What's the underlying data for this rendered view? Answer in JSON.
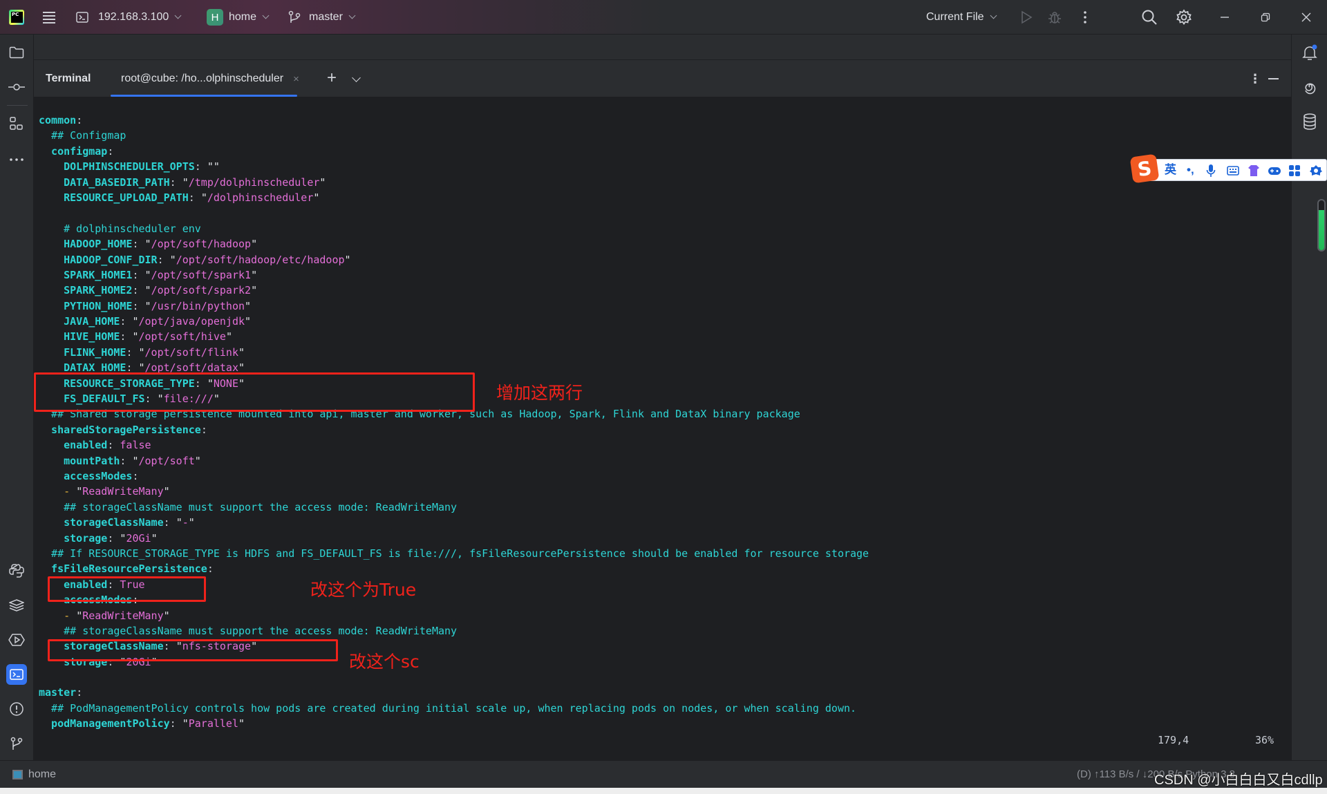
{
  "titlebar": {
    "host": "192.168.3.100",
    "project_badge": "H",
    "project": "home",
    "branch": "master",
    "run_config": "Current File"
  },
  "terminal": {
    "title": "Terminal",
    "tab_label": "root@cube: /ho...olphinscheduler",
    "tab_close": "×",
    "add": "+",
    "more": "⋮"
  },
  "code": {
    "lines": [
      [
        {
          "t": "k",
          "v": "common"
        },
        {
          "t": "p",
          "v": ":"
        }
      ],
      [
        {
          "t": "c",
          "v": "  ## Configmap"
        }
      ],
      [
        {
          "t": "k",
          "v": "  configmap"
        },
        {
          "t": "p",
          "v": ":"
        }
      ],
      [
        {
          "t": "k",
          "v": "    DOLPHINSCHEDULER_OPTS"
        },
        {
          "t": "p",
          "v": ": "
        },
        {
          "t": "q",
          "v": "\"\""
        }
      ],
      [
        {
          "t": "k",
          "v": "    DATA_BASEDIR_PATH"
        },
        {
          "t": "p",
          "v": ": "
        },
        {
          "t": "q",
          "v": "\""
        },
        {
          "t": "s",
          "v": "/tmp/dolphinscheduler"
        },
        {
          "t": "q",
          "v": "\""
        }
      ],
      [
        {
          "t": "k",
          "v": "    RESOURCE_UPLOAD_PATH"
        },
        {
          "t": "p",
          "v": ": "
        },
        {
          "t": "q",
          "v": "\""
        },
        {
          "t": "s",
          "v": "/dolphinscheduler"
        },
        {
          "t": "q",
          "v": "\""
        }
      ],
      [],
      [
        {
          "t": "c",
          "v": "    # dolphinscheduler env"
        }
      ],
      [
        {
          "t": "k",
          "v": "    HADOOP_HOME"
        },
        {
          "t": "p",
          "v": ": "
        },
        {
          "t": "q",
          "v": "\""
        },
        {
          "t": "s",
          "v": "/opt/soft/hadoop"
        },
        {
          "t": "q",
          "v": "\""
        }
      ],
      [
        {
          "t": "k",
          "v": "    HADOOP_CONF_DIR"
        },
        {
          "t": "p",
          "v": ": "
        },
        {
          "t": "q",
          "v": "\""
        },
        {
          "t": "s",
          "v": "/opt/soft/hadoop/etc/hadoop"
        },
        {
          "t": "q",
          "v": "\""
        }
      ],
      [
        {
          "t": "k",
          "v": "    SPARK_HOME1"
        },
        {
          "t": "p",
          "v": ": "
        },
        {
          "t": "q",
          "v": "\""
        },
        {
          "t": "s",
          "v": "/opt/soft/spark1"
        },
        {
          "t": "q",
          "v": "\""
        }
      ],
      [
        {
          "t": "k",
          "v": "    SPARK_HOME2"
        },
        {
          "t": "p",
          "v": ": "
        },
        {
          "t": "q",
          "v": "\""
        },
        {
          "t": "s",
          "v": "/opt/soft/spark2"
        },
        {
          "t": "q",
          "v": "\""
        }
      ],
      [
        {
          "t": "k",
          "v": "    PYTHON_HOME"
        },
        {
          "t": "p",
          "v": ": "
        },
        {
          "t": "q",
          "v": "\""
        },
        {
          "t": "s",
          "v": "/usr/bin/python"
        },
        {
          "t": "q",
          "v": "\""
        }
      ],
      [
        {
          "t": "k",
          "v": "    JAVA_HOME"
        },
        {
          "t": "p",
          "v": ": "
        },
        {
          "t": "q",
          "v": "\""
        },
        {
          "t": "s",
          "v": "/opt/java/openjdk"
        },
        {
          "t": "q",
          "v": "\""
        }
      ],
      [
        {
          "t": "k",
          "v": "    HIVE_HOME"
        },
        {
          "t": "p",
          "v": ": "
        },
        {
          "t": "q",
          "v": "\""
        },
        {
          "t": "s",
          "v": "/opt/soft/hive"
        },
        {
          "t": "q",
          "v": "\""
        }
      ],
      [
        {
          "t": "k",
          "v": "    FLINK_HOME"
        },
        {
          "t": "p",
          "v": ": "
        },
        {
          "t": "q",
          "v": "\""
        },
        {
          "t": "s",
          "v": "/opt/soft/flink"
        },
        {
          "t": "q",
          "v": "\""
        }
      ],
      [
        {
          "t": "k",
          "v": "    DATAX_HOME"
        },
        {
          "t": "p",
          "v": ": "
        },
        {
          "t": "q",
          "v": "\""
        },
        {
          "t": "s",
          "v": "/opt/soft/datax"
        },
        {
          "t": "q",
          "v": "\""
        }
      ],
      [
        {
          "t": "k",
          "v": "    RESOURCE_STORAGE_TYPE"
        },
        {
          "t": "p",
          "v": ": "
        },
        {
          "t": "q",
          "v": "\""
        },
        {
          "t": "s",
          "v": "NONE"
        },
        {
          "t": "q",
          "v": "\""
        }
      ],
      [
        {
          "t": "k",
          "v": "    FS_DEFAULT_FS"
        },
        {
          "t": "p",
          "v": ": "
        },
        {
          "t": "q",
          "v": "\""
        },
        {
          "t": "s",
          "v": "file:///"
        },
        {
          "t": "q",
          "v": "\""
        }
      ],
      [
        {
          "t": "c",
          "v": "  ## Shared storage persistence mounted into api, master and worker, such as Hadoop, Spark, Flink and DataX binary package"
        }
      ],
      [
        {
          "t": "k",
          "v": "  sharedStoragePersistence"
        },
        {
          "t": "p",
          "v": ":"
        }
      ],
      [
        {
          "t": "k",
          "v": "    enabled"
        },
        {
          "t": "p",
          "v": ": "
        },
        {
          "t": "bool",
          "v": "false"
        }
      ],
      [
        {
          "t": "k",
          "v": "    mountPath"
        },
        {
          "t": "p",
          "v": ": "
        },
        {
          "t": "q",
          "v": "\""
        },
        {
          "t": "s",
          "v": "/opt/soft"
        },
        {
          "t": "q",
          "v": "\""
        }
      ],
      [
        {
          "t": "k",
          "v": "    accessModes"
        },
        {
          "t": "p",
          "v": ":"
        }
      ],
      [
        {
          "t": "d",
          "v": "    - "
        },
        {
          "t": "q",
          "v": "\""
        },
        {
          "t": "s",
          "v": "ReadWriteMany"
        },
        {
          "t": "q",
          "v": "\""
        }
      ],
      [
        {
          "t": "c",
          "v": "    ## storageClassName must support the access mode: ReadWriteMany"
        }
      ],
      [
        {
          "t": "k",
          "v": "    storageClassName"
        },
        {
          "t": "p",
          "v": ": "
        },
        {
          "t": "q",
          "v": "\""
        },
        {
          "t": "s",
          "v": "-"
        },
        {
          "t": "q",
          "v": "\""
        }
      ],
      [
        {
          "t": "k",
          "v": "    storage"
        },
        {
          "t": "p",
          "v": ": "
        },
        {
          "t": "q",
          "v": "\""
        },
        {
          "t": "s",
          "v": "20Gi"
        },
        {
          "t": "q",
          "v": "\""
        }
      ],
      [
        {
          "t": "c",
          "v": "  ## If RESOURCE_STORAGE_TYPE is HDFS and FS_DEFAULT_FS is file:///, fsFileResourcePersistence should be enabled for resource storage"
        }
      ],
      [
        {
          "t": "k",
          "v": "  fsFileResourcePersistence"
        },
        {
          "t": "p",
          "v": ":"
        }
      ],
      [
        {
          "t": "k",
          "v": "    enabled"
        },
        {
          "t": "p",
          "v": ": "
        },
        {
          "t": "bool",
          "v": "True"
        }
      ],
      [
        {
          "t": "k",
          "v": "    accessModes"
        },
        {
          "t": "p",
          "v": ":"
        }
      ],
      [
        {
          "t": "d",
          "v": "    - "
        },
        {
          "t": "q",
          "v": "\""
        },
        {
          "t": "s",
          "v": "ReadWriteMany"
        },
        {
          "t": "q",
          "v": "\""
        }
      ],
      [
        {
          "t": "c",
          "v": "    ## storageClassName must support the access mode: ReadWriteMany"
        }
      ],
      [
        {
          "t": "k",
          "v": "    storageClassName"
        },
        {
          "t": "p",
          "v": ": "
        },
        {
          "t": "q",
          "v": "\""
        },
        {
          "t": "s",
          "v": "nfs-storage"
        },
        {
          "t": "q",
          "v": "\""
        }
      ],
      [
        {
          "t": "k",
          "v": "    storage"
        },
        {
          "t": "p",
          "v": ": "
        },
        {
          "t": "q",
          "v": "\""
        },
        {
          "t": "s",
          "v": "20Gi"
        },
        {
          "t": "q",
          "v": "\""
        }
      ],
      [],
      [
        {
          "t": "k",
          "v": "master"
        },
        {
          "t": "p",
          "v": ":"
        }
      ],
      [
        {
          "t": "c",
          "v": "  ## PodManagementPolicy controls how pods are created during initial scale up, when replacing pods on nodes, or when scaling down."
        }
      ],
      [
        {
          "t": "k",
          "v": "  podManagementPolicy"
        },
        {
          "t": "p",
          "v": ": "
        },
        {
          "t": "q",
          "v": "\""
        },
        {
          "t": "s",
          "v": "Parallel"
        },
        {
          "t": "q",
          "v": "\""
        }
      ]
    ]
  },
  "annotations": {
    "add_two_lines": "增加这两行",
    "change_to_true": "改这个为True",
    "change_sc": "改这个sc"
  },
  "cursor": {
    "position": "179,4",
    "percent": "36%"
  },
  "ime": {
    "logo": "S",
    "mode": "英",
    "punct": "•,"
  },
  "memory_gauge": {
    "fill_fraction": 0.8
  },
  "statusbar": {
    "project": "home",
    "right": "(D) ↑113 B/s / ↓200 B/s      Python 3.8"
  },
  "watermark": "CSDN @小白白白又白cdllp",
  "colors": {
    "accent": "#3574f0",
    "annotation": "#f0221b",
    "key": "#2ed5d5",
    "string": "#e46fd8"
  }
}
